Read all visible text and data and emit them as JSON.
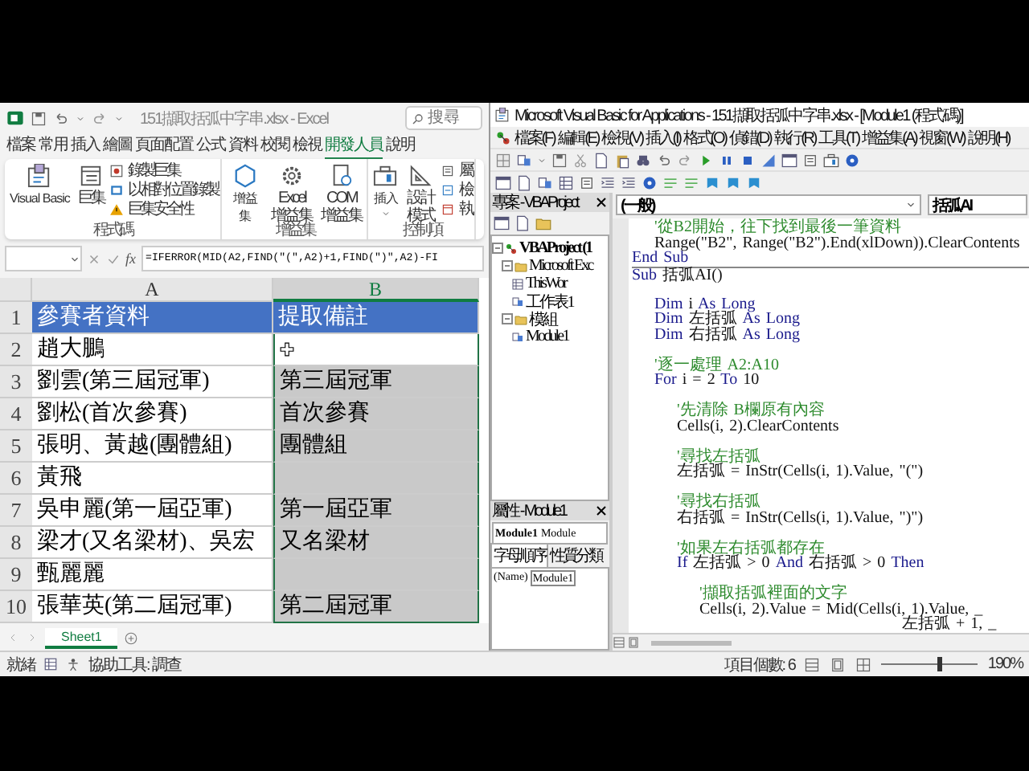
{
  "excel": {
    "title": "151擷取括弧中字串.xlsx - Excel",
    "search": {
      "placeholder": "搜尋"
    },
    "ribbon_tabs": [
      {
        "label": "檔案",
        "selected": false
      },
      {
        "label": "常用",
        "selected": false
      },
      {
        "label": "插入",
        "selected": false
      },
      {
        "label": "繪圖",
        "selected": false
      },
      {
        "label": "頁面配置",
        "selected": false
      },
      {
        "label": "公式",
        "selected": false
      },
      {
        "label": "資料",
        "selected": false
      },
      {
        "label": "校閱",
        "selected": false
      },
      {
        "label": "檢視",
        "selected": false
      },
      {
        "label": "開發人員",
        "selected": true
      },
      {
        "label": "說明",
        "selected": false
      }
    ],
    "ribbon_groups": [
      {
        "label": "程式碼",
        "items": [
          {
            "kind": "large",
            "label": "Visual Basic"
          },
          {
            "kind": "large",
            "label": "巨集"
          },
          {
            "kind": "stack",
            "items": [
              {
                "label": "錄製巨集"
              },
              {
                "label": "以相對位置錄製"
              },
              {
                "label": "巨集安全性"
              }
            ]
          }
        ]
      },
      {
        "label": "增益集",
        "items": [
          {
            "kind": "narrow",
            "label": "增益集"
          },
          {
            "kind": "narrow",
            "label": "Excel 增益集"
          },
          {
            "kind": "narrow",
            "label": "COM 增益集"
          }
        ]
      },
      {
        "label": "控制項",
        "items": [
          {
            "kind": "dropdown",
            "label": "插入"
          },
          {
            "kind": "narrow",
            "label": "設計模式"
          },
          {
            "kind": "stack",
            "items": [
              {
                "label": "屬"
              },
              {
                "label": "檢"
              },
              {
                "label": "執"
              }
            ]
          }
        ]
      }
    ],
    "formula_bar": {
      "function_label": "fx",
      "formula": "=IFERROR(MID(A2,FIND(\"(\",A2)+1,FIND(\")\",A2)-FI"
    },
    "columns": [
      {
        "label": "A",
        "selected": false
      },
      {
        "label": "B",
        "selected": true
      }
    ],
    "header_row": {
      "number": "1",
      "a": "參賽者資料",
      "b": "提取備註"
    },
    "rows": [
      {
        "number": "2",
        "a": "趙大鵬",
        "b_selected": true,
        "b_active": true
      },
      {
        "number": "3",
        "a": "劉雲(第三屆冠軍)",
        "b": "第三屆冠軍",
        "b_selected": true,
        "b_active": false
      },
      {
        "number": "4",
        "a": "劉松(首次參賽)",
        "b": "首次參賽",
        "b_selected": true,
        "b_active": false
      },
      {
        "number": "5",
        "a": "張明、黃越(團體組)",
        "b": "團體組",
        "b_selected": true,
        "b_active": false
      },
      {
        "number": "6",
        "a": "黃飛",
        "b_selected": true,
        "b_active": false
      },
      {
        "number": "7",
        "a": "吳申麗(第一屆亞軍)",
        "b": "第一屆亞軍",
        "b_selected": true,
        "b_active": false
      },
      {
        "number": "8",
        "a": "梁才(又名梁材)、吳宏",
        "b": "又名梁材",
        "b_selected": true,
        "b_active": false
      },
      {
        "number": "9",
        "a": "甄麗麗",
        "b_selected": true,
        "b_active": false
      },
      {
        "number": "10",
        "a": "張華英(第二屆冠軍)",
        "b": "第二屆冠軍",
        "b_selected": true,
        "b_active": false
      }
    ],
    "sheet_tabs": [
      {
        "label": "Sheet1",
        "selected": true
      }
    ],
    "status": {
      "ready": "就緒",
      "accessibility": "協助工具: 調查"
    }
  },
  "vba": {
    "title": "Microsoft Visual Basic for Applications - 151擷取括弧中字串.xlsx - [Module1 (程式碼)]",
    "menu": [
      "檔案(F)",
      "編輯(E)",
      "檢視(V)",
      "插入(I)",
      "格式(O)",
      "偵錯(D)",
      "執行(R)",
      "工具(T)",
      "增益集(A)",
      "視窗(W)",
      "說明(H)"
    ],
    "project": {
      "title": "專案 - VBAProject",
      "tree": [
        {
          "label": "VBAProject (1",
          "expanded": true,
          "children": [
            {
              "label": "Microsoft Exc",
              "expanded": true,
              "children": [
                {
                  "label": "ThisWor"
                },
                {
                  "label": "工作表1"
                }
              ]
            },
            {
              "label": "模組",
              "expanded": true,
              "children": [
                {
                  "label": "Module1"
                }
              ]
            }
          ]
        }
      ]
    },
    "properties": {
      "title": "屬性 - Module1",
      "object": "Module1",
      "object_type": "Module",
      "tabs": [
        {
          "label": "字母順序",
          "selected": true
        },
        {
          "label": "性質分類",
          "selected": false
        }
      ],
      "rows": [
        {
          "name": "(Name)",
          "value": "Module1"
        }
      ]
    },
    "code": {
      "object": "(一般)",
      "procedure": "括弧AI",
      "lines": [
        {
          "segments": [
            {
              "kind": "comment",
              "text": "    '從B2開始，往下找到最後一筆資料"
            }
          ]
        },
        {
          "segments": [
            {
              "kind": "plain",
              "text": "    Range(\"B2\", Range(\"B2\").End(xlDown)).ClearContents"
            }
          ]
        },
        {
          "segments": [
            {
              "kind": "keyword",
              "text": "End Sub"
            }
          ]
        },
        {
          "separator": true,
          "segments": [
            {
              "kind": "keyword",
              "text": "Sub"
            },
            {
              "kind": "plain",
              "text": " 括弧AI()"
            }
          ]
        },
        {
          "space_before": true,
          "segments": [
            {
              "kind": "keyword",
              "text": "    Dim"
            },
            {
              "kind": "plain",
              "text": " i "
            },
            {
              "kind": "keyword",
              "text": "As Long"
            }
          ]
        },
        {
          "segments": [
            {
              "kind": "keyword",
              "text": "    Dim"
            },
            {
              "kind": "plain",
              "text": " 左括弧 "
            },
            {
              "kind": "keyword",
              "text": "As Long"
            }
          ]
        },
        {
          "segments": [
            {
              "kind": "keyword",
              "text": "    Dim"
            },
            {
              "kind": "plain",
              "text": " 右括弧 "
            },
            {
              "kind": "keyword",
              "text": "As Long"
            }
          ]
        },
        {
          "space_before": true,
          "segments": [
            {
              "kind": "comment",
              "text": "    '逐一處理 A2:A10"
            }
          ]
        },
        {
          "segments": [
            {
              "kind": "keyword",
              "text": "    For"
            },
            {
              "kind": "plain",
              "text": " i = 2 "
            },
            {
              "kind": "keyword",
              "text": "To"
            },
            {
              "kind": "plain",
              "text": " 10"
            }
          ]
        },
        {
          "space_before": true,
          "segments": [
            {
              "kind": "comment",
              "text": "        '先清除 B欄原有內容"
            }
          ]
        },
        {
          "segments": [
            {
              "kind": "plain",
              "text": "        Cells(i, 2).ClearContents"
            }
          ]
        },
        {
          "space_before": true,
          "segments": [
            {
              "kind": "comment",
              "text": "        '尋找左括弧"
            }
          ]
        },
        {
          "segments": [
            {
              "kind": "plain",
              "text": "        左括弧 = InStr(Cells(i, 1).Value, \"(\")"
            }
          ]
        },
        {
          "space_before": true,
          "segments": [
            {
              "kind": "comment",
              "text": "        '尋找右括弧"
            }
          ]
        },
        {
          "segments": [
            {
              "kind": "plain",
              "text": "        右括弧 = InStr(Cells(i, 1).Value, \")\")"
            }
          ]
        },
        {
          "space_before": true,
          "segments": [
            {
              "kind": "comment",
              "text": "        '如果左右括弧都存在"
            }
          ]
        },
        {
          "segments": [
            {
              "kind": "keyword",
              "text": "        If"
            },
            {
              "kind": "plain",
              "text": " 左括弧 > 0 "
            },
            {
              "kind": "keyword",
              "text": "And"
            },
            {
              "kind": "plain",
              "text": " 右括弧 > 0 "
            },
            {
              "kind": "keyword",
              "text": "Then"
            }
          ]
        },
        {
          "space_before": true,
          "segments": [
            {
              "kind": "comment",
              "text": "            '擷取括弧裡面的文字"
            }
          ]
        },
        {
          "segments": [
            {
              "kind": "plain",
              "text": "            Cells(i, 2).Value = Mid(Cells(i, 1).Value, _"
            }
          ]
        },
        {
          "segments": [
            {
              "kind": "plain",
              "text": "                                                左括弧 + 1, _"
            }
          ]
        }
      ]
    },
    "status": {
      "item_count": "項目個數: 6",
      "zoom": {
        "level": 0.6,
        "reading": "190%"
      }
    }
  }
}
